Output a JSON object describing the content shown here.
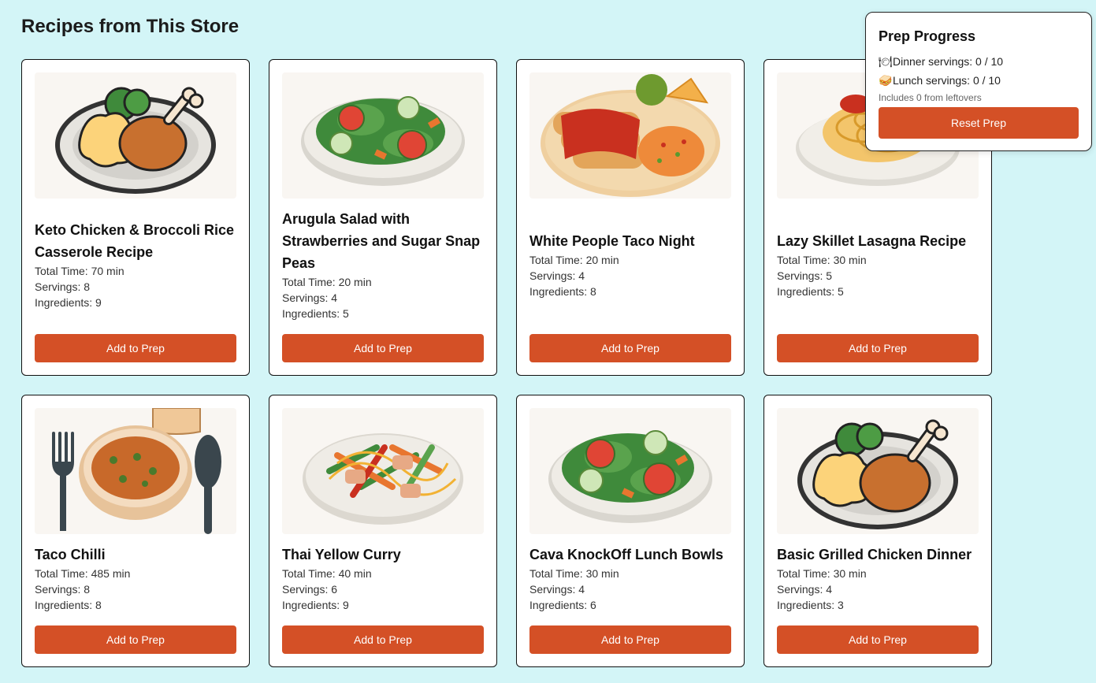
{
  "page": {
    "title": "Recipes from This Store"
  },
  "recipes": [
    {
      "title": "Keto Chicken & Broccoli Rice Casserole Recipe",
      "total_time": "Total Time: 70 min",
      "servings": "Servings: 8",
      "ingredients": "Ingredients: 9",
      "button": "Add to Prep",
      "image": "chicken-plate"
    },
    {
      "title": "Arugula Salad with Strawberries and Sugar Snap Peas",
      "total_time": "Total Time: 20 min",
      "servings": "Servings: 4",
      "ingredients": "Ingredients: 5",
      "button": "Add to Prep",
      "image": "salad"
    },
    {
      "title": "White People Taco Night",
      "total_time": "Total Time: 20 min",
      "servings": "Servings: 4",
      "ingredients": "Ingredients: 8",
      "button": "Add to Prep",
      "image": "enchiladas"
    },
    {
      "title": "Lazy Skillet Lasagna Recipe",
      "total_time": "Total Time: 30 min",
      "servings": "Servings: 5",
      "ingredients": "Ingredients: 5",
      "button": "Add to Prep",
      "image": "pasta"
    },
    {
      "title": "Taco Chilli",
      "total_time": "Total Time: 485 min",
      "servings": "Servings: 8",
      "ingredients": "Ingredients: 8",
      "button": "Add to Prep",
      "image": "soup-bowl"
    },
    {
      "title": "Thai Yellow Curry",
      "total_time": "Total Time: 40 min",
      "servings": "Servings: 6",
      "ingredients": "Ingredients: 9",
      "button": "Add to Prep",
      "image": "stir-fry"
    },
    {
      "title": "Cava KnockOff Lunch Bowls",
      "total_time": "Total Time: 30 min",
      "servings": "Servings: 4",
      "ingredients": "Ingredients: 6",
      "button": "Add to Prep",
      "image": "salad"
    },
    {
      "title": "Basic Grilled Chicken Dinner",
      "total_time": "Total Time: 30 min",
      "servings": "Servings: 4",
      "ingredients": "Ingredients: 3",
      "button": "Add to Prep",
      "image": "chicken-plate"
    }
  ],
  "prep": {
    "title": "Prep Progress",
    "dinner_icon": "plate-icon",
    "dinner": "Dinner servings: 0 / 10",
    "lunch_icon": "sandwich-icon",
    "lunch": "Lunch servings: 0 / 10",
    "note": "Includes 0 from leftovers",
    "reset": "Reset Prep"
  },
  "colors": {
    "background": "#d3f5f7",
    "accent": "#d45026"
  }
}
